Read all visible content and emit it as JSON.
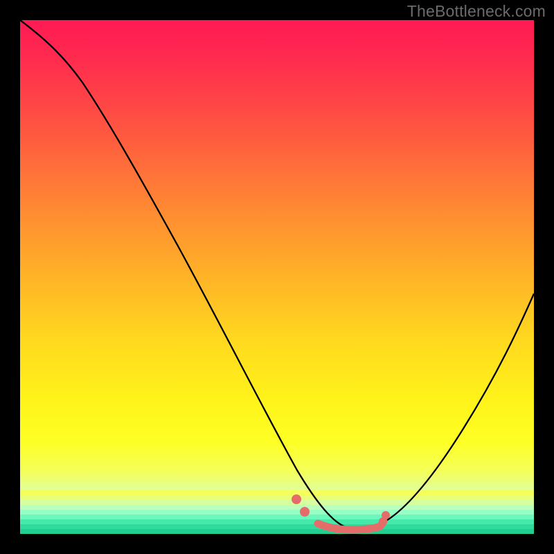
{
  "watermark": "TheBottleneck.com",
  "colors": {
    "curve": "#000000",
    "marker": "#e46d6a",
    "background_black": "#000000"
  },
  "chart_data": {
    "type": "line",
    "title": "",
    "xlabel": "",
    "ylabel": "",
    "xlim": [
      0,
      100
    ],
    "ylim": [
      0,
      100
    ],
    "series": [
      {
        "name": "bottleneck-curve",
        "x": [
          0,
          5,
          10,
          15,
          20,
          25,
          30,
          35,
          40,
          45,
          50,
          53,
          55,
          58,
          60,
          63,
          65,
          67,
          70,
          75,
          80,
          85,
          90,
          95,
          100
        ],
        "y": [
          100,
          97,
          92,
          85,
          77,
          68,
          59,
          49,
          39,
          29,
          19,
          13,
          8,
          4,
          2,
          1,
          1,
          1,
          2,
          5,
          12,
          22,
          33,
          42,
          50
        ]
      }
    ],
    "markers": {
      "name": "highlighted-range",
      "x": [
        53,
        55,
        58,
        60,
        62,
        64,
        66,
        68,
        70
      ],
      "y": [
        6,
        3,
        1,
        1,
        1,
        1,
        1,
        1,
        2
      ]
    },
    "gradient_meaning": "top=red (high bottleneck) → bottom=green (low bottleneck)"
  }
}
